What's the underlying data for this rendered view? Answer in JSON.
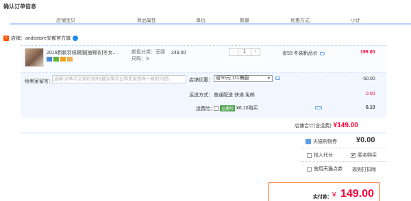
{
  "page_title": "确认订单信息",
  "table_headers": [
    "店铺宝贝",
    "商品属性",
    "单价",
    "数量",
    "优惠方式",
    "小计"
  ],
  "shop": {
    "label": "店铺：andostore安都官方旗"
  },
  "item": {
    "name": "2016新款羽绒棉服[抽棉衣]冬女...",
    "props": [
      "颜色分类：豆绿",
      "尺码：S"
    ],
    "price": "249.00",
    "quantity": "1",
    "qty_minus": "-",
    "qty_plus": "+",
    "promo": "省50:冬装新品价",
    "subtotal": "199.00"
  },
  "message": {
    "label": "给卖家留言：",
    "placeholder": "选填:对本次交易的说明(建议填写已和卖家协商一致的内容)"
  },
  "shop_discount": {
    "label": "店铺优惠：",
    "selected": "省50元:111稿服",
    "value": "-50.00"
  },
  "shipping": {
    "label": "运送方式：",
    "text": "普通配送 快递 免邮",
    "value": "0.00"
  },
  "insurance": {
    "label": "运费险：",
    "badge": "运费险",
    "text": "¥6.10购买",
    "value": "6.10"
  },
  "shop_total": {
    "label": "店铺合计(含运费)",
    "amount": "¥149.00"
  },
  "tmall_points": {
    "label": "天猫购物券",
    "amount": "¥0.00"
  },
  "options": {
    "proxy_pay": "找人代付",
    "anonymous": "匿名购买",
    "use_points": "使用天猫点券",
    "view_note": "规则打扣除"
  },
  "final": {
    "label": "实付款：",
    "symbol": "¥",
    "amount": "149.00"
  },
  "colors": {
    "accent_red": "#ff0036",
    "border_blue": "#b2d1ff",
    "frame_orange": "#ff5500"
  }
}
